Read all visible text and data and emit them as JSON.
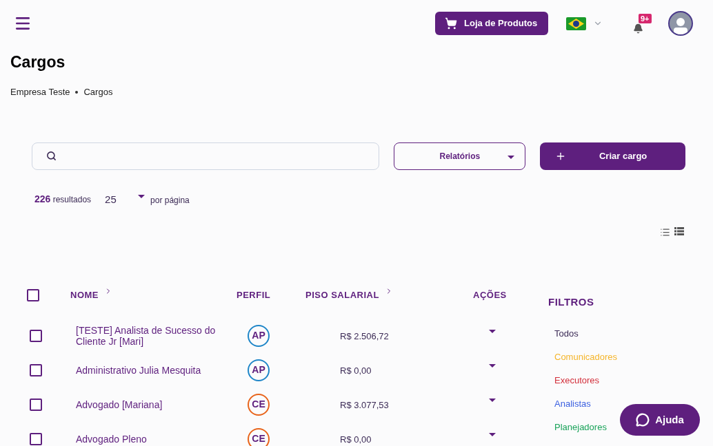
{
  "header": {
    "store_button": "Loja de Produtos",
    "notifications_badge": "9+"
  },
  "page": {
    "title": "Cargos",
    "breadcrumb": [
      "Empresa Teste",
      "Cargos"
    ]
  },
  "toolbar": {
    "reports": "Relatórios",
    "create": "Criar cargo"
  },
  "results": {
    "count": "226",
    "count_label": "resultados",
    "per_page": "25",
    "per_page_label": "por página"
  },
  "table": {
    "columns": [
      {
        "label": "NOME",
        "sortable": true
      },
      {
        "label": "PERFIL",
        "sortable": false
      },
      {
        "label": "PISO SALARIAL",
        "sortable": true
      },
      {
        "label": "AÇÕES",
        "sortable": false
      }
    ],
    "select_all_checked": false,
    "rows": [
      {
        "name": "[TESTE] Analista de Sucesso do Cliente Jr [Mari]",
        "profile": "AP",
        "color": "#1f86c8",
        "salary": "R$ 2.506,72",
        "checked": false
      },
      {
        "name": "Administrativo Julia Mesquita",
        "profile": "AP",
        "color": "#1f86c8",
        "salary": "R$ 0,00",
        "checked": false
      },
      {
        "name": "Advogado [Mariana]",
        "profile": "CE",
        "color": "#e8641b",
        "salary": "R$ 3.077,53",
        "checked": false
      },
      {
        "name": "Advogado Pleno",
        "profile": "CE",
        "color": "#e8641b",
        "salary": "R$ 0,00",
        "checked": false
      }
    ]
  },
  "filters": {
    "title": "FILTROS",
    "items": [
      {
        "label": "Todos",
        "color": "#3b2a55"
      },
      {
        "label": "Comunicadores",
        "color": "#f5b52a"
      },
      {
        "label": "Executores",
        "color": "#d3303c"
      },
      {
        "label": "Analistas",
        "color": "#3a5fe0"
      },
      {
        "label": "Planejadores",
        "color": "#1aa35a"
      }
    ]
  },
  "help_button": "Ajuda"
}
